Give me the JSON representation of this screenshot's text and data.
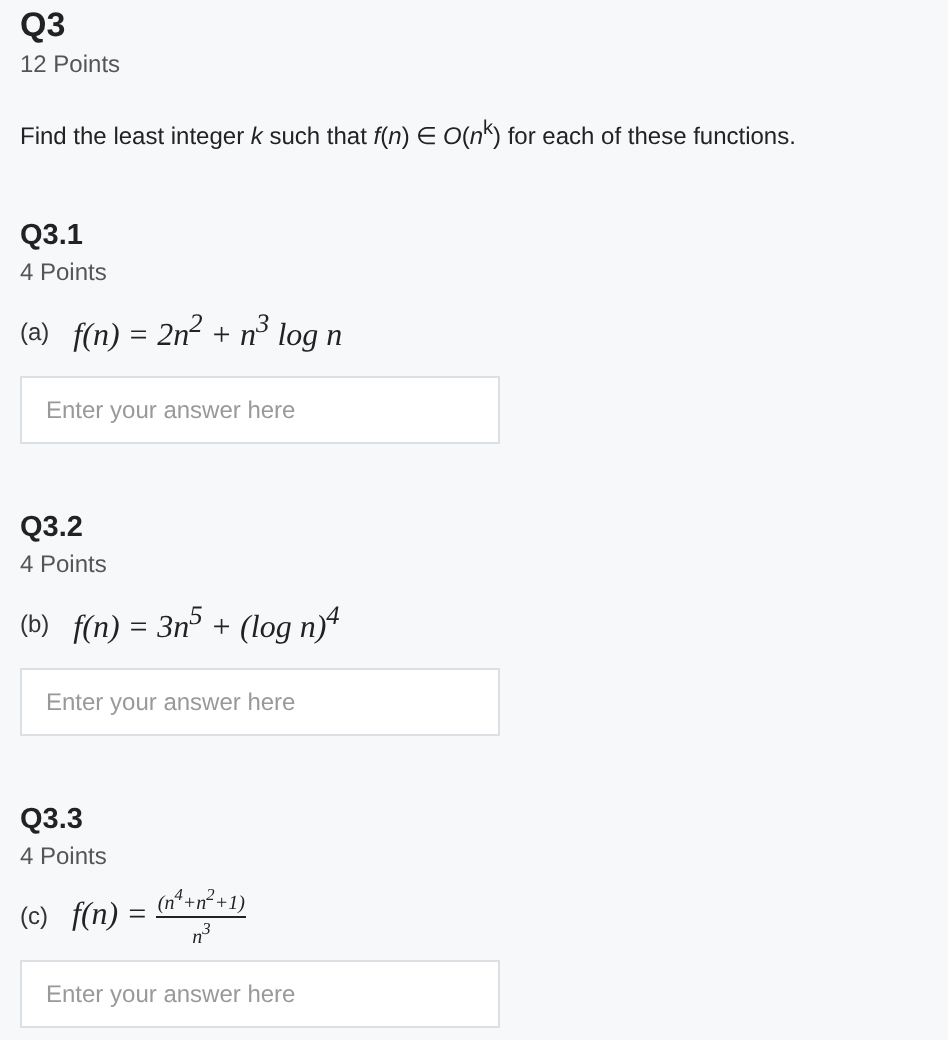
{
  "question": {
    "title": "Q3",
    "points": "12 Points",
    "prompt": "Find the least integer *k* such that *f*(*n*) ∈ *O*(*n*$^{k}$) for each of these functions."
  },
  "parts": [
    {
      "title": "Q3.1",
      "points": "4 Points",
      "label": "(a)",
      "formula": {
        "kind": "inline",
        "text": "f(n) = 2n$^{2}$ + n$^{3}$ log n"
      },
      "answer": {
        "placeholder": "Enter your answer here"
      }
    },
    {
      "title": "Q3.2",
      "points": "4 Points",
      "label": "(b)",
      "formula": {
        "kind": "inline",
        "text": "f(n) = 3n$^{5}$ + (log n)$^{4}$"
      },
      "answer": {
        "placeholder": "Enter your answer here"
      }
    },
    {
      "title": "Q3.3",
      "points": "4 Points",
      "label": "(c)",
      "formula": {
        "kind": "fraction",
        "lhs": "f(n) =",
        "numerator": "(n$^{4}$+n$^{2}$+1)",
        "denominator": "n$^{3}$"
      },
      "answer": {
        "placeholder": "Enter your answer here"
      }
    }
  ]
}
